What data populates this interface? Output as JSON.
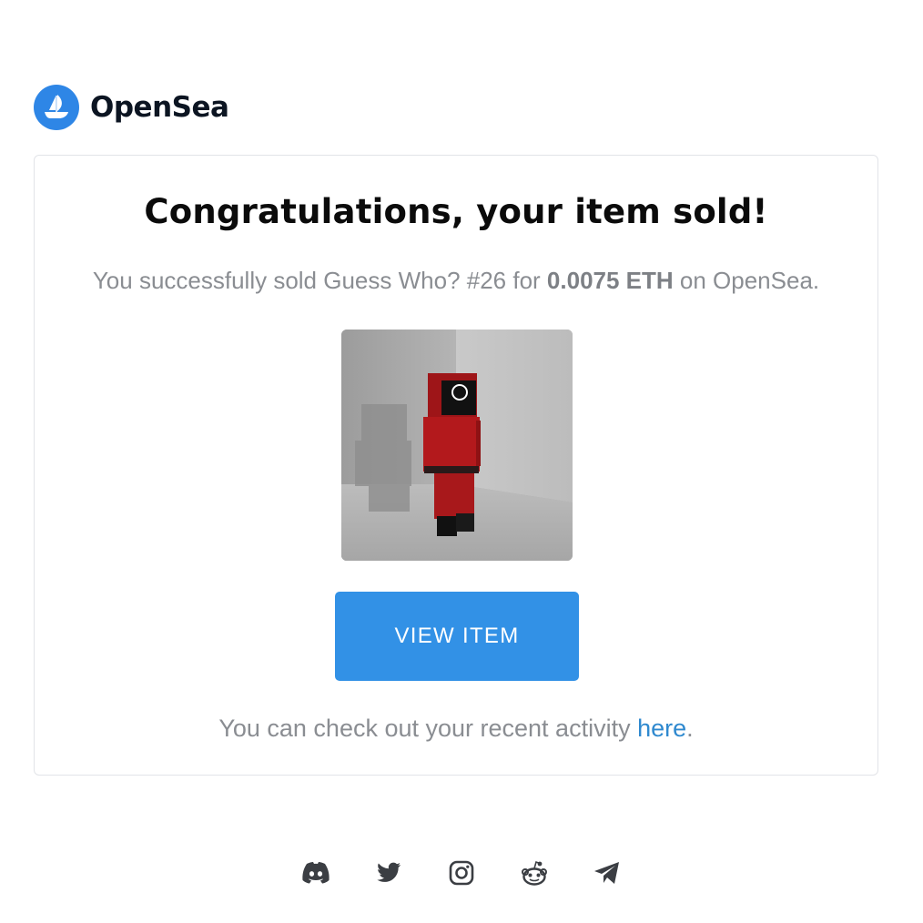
{
  "brand": {
    "name": "OpenSea",
    "accent_color": "#2e86e6",
    "logo_icon": "opensea-boat-icon"
  },
  "card": {
    "title": "Congratulations, your item sold!",
    "message": {
      "prefix": "You successfully sold Guess Who? #26 for ",
      "price": "0.0075 ETH",
      "suffix": " on OpenSea."
    },
    "image": {
      "description_icon": "nft-red-jumpsuit-figure-image"
    },
    "button": {
      "label": "VIEW ITEM",
      "color": "#3291e6"
    },
    "footer": {
      "prefix": "You can check out your recent activity ",
      "link_text": "here",
      "suffix": "."
    }
  },
  "socials": [
    {
      "icon": "discord-icon"
    },
    {
      "icon": "twitter-icon"
    },
    {
      "icon": "instagram-icon"
    },
    {
      "icon": "reddit-icon"
    },
    {
      "icon": "telegram-icon"
    }
  ]
}
